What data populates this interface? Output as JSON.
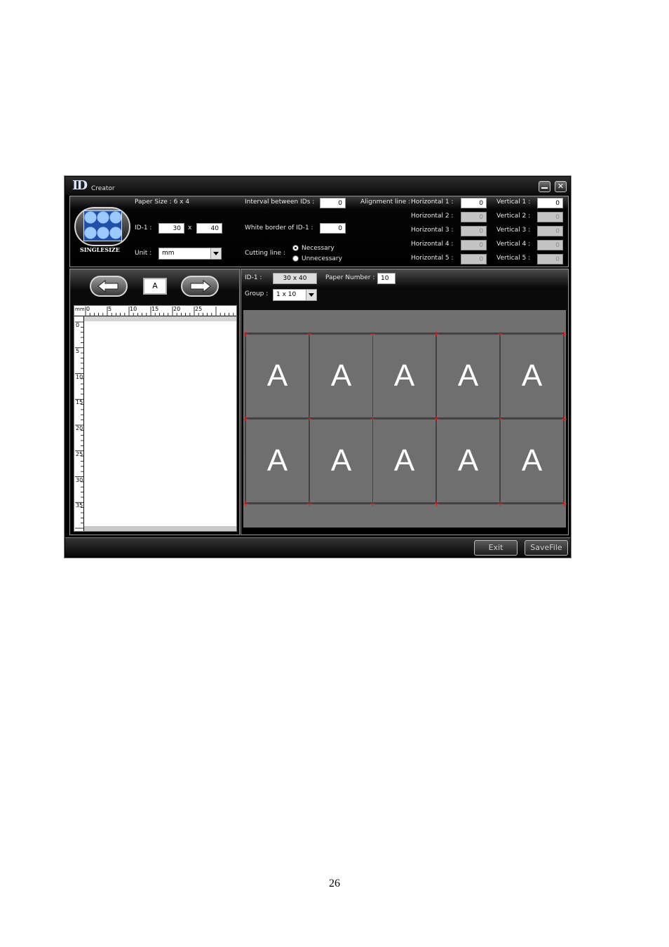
{
  "window": {
    "app_logo_text": "ID",
    "app_title": "Creator",
    "minimize_label": "–",
    "close_label": "✕"
  },
  "settings": {
    "mode_logo_text": "SINGLESIZE",
    "paper_size": "Paper Size : 6 x 4",
    "id1_label": "ID-1 :",
    "id1_width": "30",
    "id1_x": "x",
    "id1_height": "40",
    "unit_label": "Unit :",
    "unit_value": "mm",
    "interval_label": "Interval between IDs :",
    "interval_value": "0",
    "white_border_label": "White border of ID-1 :",
    "white_border_value": "0",
    "cutting_line_label": "Cutting line :",
    "cutting_necessary": "Necessary",
    "cutting_unnecessary": "Unnecessary",
    "alignment_label": "Alignment line :",
    "horizontal": [
      {
        "label": "Horizontal 1 :",
        "value": "0"
      },
      {
        "label": "Horizontal 2 :",
        "value": "0"
      },
      {
        "label": "Horizontal 3 :",
        "value": "0"
      },
      {
        "label": "Horizontal 4 :",
        "value": "0"
      },
      {
        "label": "Horizontal 5 :",
        "value": "0"
      }
    ],
    "vertical": [
      {
        "label": "Vertical 1 :",
        "value": "0"
      },
      {
        "label": "Vertical 2 :",
        "value": "0"
      },
      {
        "label": "Vertical 3 :",
        "value": "0"
      },
      {
        "label": "Vertical 4 :",
        "value": "0"
      },
      {
        "label": "Vertical 5 :",
        "value": "0"
      }
    ]
  },
  "editor": {
    "current_id": "A",
    "ruler_unit": "mm",
    "ruler_h_labels": [
      "0",
      "5",
      "10",
      "15",
      "20",
      "25"
    ],
    "ruler_v_labels": [
      "0",
      "5",
      "10",
      "15",
      "20",
      "25",
      "30",
      "35"
    ]
  },
  "preview": {
    "id_label": "ID-1 :",
    "id_size": "30 x 40",
    "paper_number_label": "Paper Number :",
    "paper_number": "10",
    "group_label": "Group :",
    "group_value": "1 x 10",
    "cells": [
      "A",
      "A",
      "A",
      "A",
      "A",
      "A",
      "A",
      "A",
      "A",
      "A"
    ]
  },
  "footer": {
    "exit_label": "Exit",
    "savefile_label": "SaveFile"
  },
  "page_number": "26"
}
